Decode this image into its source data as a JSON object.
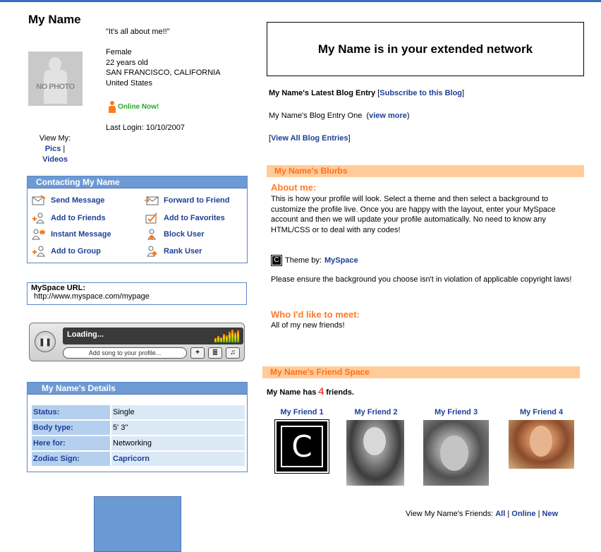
{
  "profile": {
    "name": "My Name",
    "headline": "\"It's all about me!!\"",
    "gender": "Female",
    "age": "22 years old",
    "city": "SAN FRANCISCO, CALIFORNIA",
    "country": "United States",
    "online_status": "Online Now!",
    "last_login": "Last Login: 10/10/2007",
    "photo_placeholder": "NO PHOTO",
    "view_my_label": "View My:",
    "view_pics": "Pics",
    "view_sep": "|",
    "view_videos": "Videos"
  },
  "contact": {
    "title": "Contacting My Name",
    "items": [
      {
        "label": "Send Message",
        "icon": "send-message-icon"
      },
      {
        "label": "Forward to Friend",
        "icon": "forward-icon"
      },
      {
        "label": "Add to Friends",
        "icon": "add-friend-icon"
      },
      {
        "label": "Add to Favorites",
        "icon": "favorites-icon"
      },
      {
        "label": "Instant Message",
        "icon": "instant-message-icon"
      },
      {
        "label": "Block User",
        "icon": "block-user-icon"
      },
      {
        "label": "Add to Group",
        "icon": "add-group-icon"
      },
      {
        "label": "Rank User",
        "icon": "rank-user-icon"
      }
    ]
  },
  "myspace_url": {
    "title": "MySpace URL:",
    "value": "http://www.myspace.com/mypage"
  },
  "player": {
    "status": "Loading...",
    "add_song": "Add song to your profile..."
  },
  "details": {
    "title": "My Name's Details",
    "rows": [
      {
        "key": "Status:",
        "value": "Single"
      },
      {
        "key": "Body type:",
        "value": "5' 3\""
      },
      {
        "key": "Here for:",
        "value": "Networking"
      },
      {
        "key": "Zodiac Sign:",
        "value": "Capricorn"
      }
    ]
  },
  "network": {
    "text": "My Name is in your extended network"
  },
  "blog": {
    "title": "My Name's Latest Blog Entry",
    "subscribe": "Subscribe to this Blog",
    "entry": "My Name's Blog Entry One",
    "view_more": "view more",
    "view_all": "View All Blog Entries"
  },
  "blurbs": {
    "title": "My Name's Blurbs",
    "about_title": "About me:",
    "about_text": "This is how your profile will look. Select a theme and then select a background to customize the profile live. Once you are happy with the layout, enter your MySpace account and then we will update your profile automatically. No need to know any HTML/CSS or to deal with any codes!",
    "theme_label": "Theme by:",
    "theme_link": "MySpace",
    "ensure_text": "Please ensure the background you choose isn't in violation of applicable copyright laws!",
    "meet_title": "Who I'd like to meet:",
    "meet_text": "All of my new friends!"
  },
  "friends": {
    "title": "My Name's Friend Space",
    "count_prefix": "My Name has",
    "count": "4",
    "count_suffix": "friends.",
    "list": [
      {
        "name": "My Friend 1"
      },
      {
        "name": "My Friend 2"
      },
      {
        "name": "My Friend 3"
      },
      {
        "name": "My Friend 4"
      }
    ],
    "view_label": "View My Name's Friends:",
    "view_all": "All",
    "view_online": "Online",
    "view_new": "New"
  },
  "colors": {
    "accent_blue": "#6d9ad4",
    "link_blue": "#1e3f96",
    "orange": "#ff7a2a",
    "section_bg": "#ffcc99",
    "online_green": "#2aa52a"
  }
}
